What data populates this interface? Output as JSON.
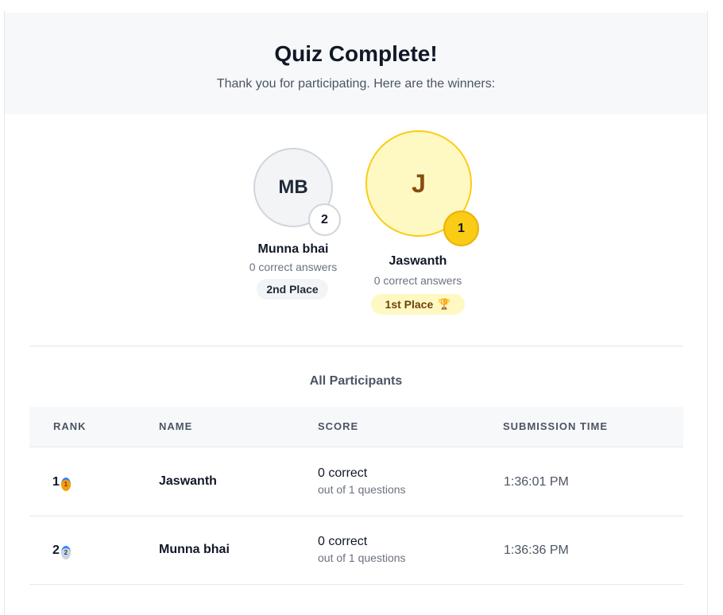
{
  "header": {
    "title": "Quiz Complete!",
    "subtitle": "Thank you for participating. Here are the winners:"
  },
  "podium": {
    "second": {
      "initials": "MB",
      "rank": "2",
      "name": "Munna bhai",
      "score": "0 correct answers",
      "place": "2nd Place"
    },
    "first": {
      "initials": "J",
      "rank": "1",
      "name": "Jaswanth",
      "score": "0 correct answers",
      "place": "1st Place",
      "place_icon": "trophy-icon",
      "place_glyph": "🏆"
    }
  },
  "participants": {
    "title": "All Participants",
    "columns": [
      "RANK",
      "NAME",
      "SCORE",
      "SUBMISSION TIME"
    ],
    "rows": [
      {
        "rank": "1",
        "medal": "gold-medal-icon",
        "medal_glyph": "1",
        "name": "Jaswanth",
        "score": "0 correct",
        "score_sub": "out of 1 questions",
        "time": "1:36:01 PM"
      },
      {
        "rank": "2",
        "medal": "silver-medal-icon",
        "medal_glyph": "2",
        "name": "Munna bhai",
        "score": "0 correct",
        "score_sub": "out of 1 questions",
        "time": "1:36:36 PM"
      }
    ]
  },
  "colors": {
    "gold": "#facc15",
    "gold_bg": "#fef9c3",
    "silver_border": "#d1d5db",
    "header_bg": "#f7f8fa"
  }
}
